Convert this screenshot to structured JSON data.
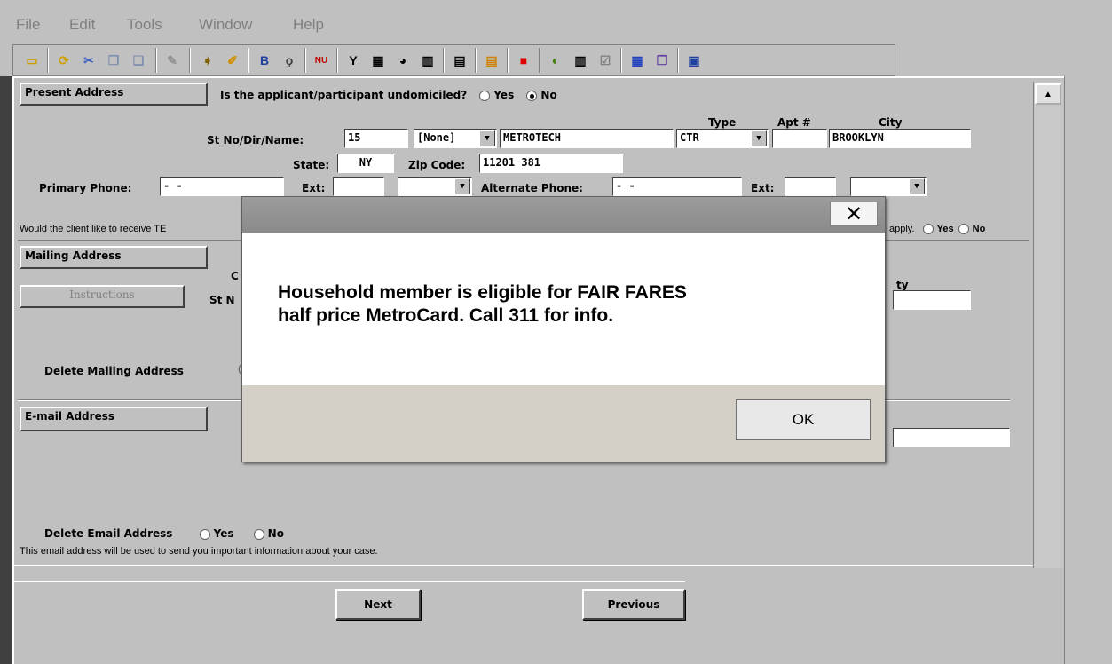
{
  "menu": [
    "File",
    "Edit",
    "Tools",
    "Window",
    "Help"
  ],
  "present": {
    "section_label": "Present Address",
    "undomiciled_question": "Is the applicant/participant undomiciled?",
    "yes": "Yes",
    "no": "No",
    "selected": "No",
    "type_header": "Type",
    "apt_header": "Apt #",
    "city_header": "City",
    "st_label": "St No/Dir/Name:",
    "st_no": "15",
    "dir": "[None]",
    "street": "METROTECH",
    "type": "CTR",
    "apt": "",
    "city": "BROOKLYN",
    "state_label": "State:",
    "state": "NY",
    "zip_label": "Zip Code:",
    "zip": "11201 381",
    "primary_phone_label": "Primary Phone:",
    "primary_phone": " -  -",
    "ext_label": "Ext:",
    "ext": "",
    "alt_phone_label": "Alternate Phone:",
    "alt_phone": " -  -",
    "alt_ext_label": "Ext:",
    "alt_ext": ""
  },
  "text_question_start": "Would the client like to receive TE",
  "text_question_end": "apply.",
  "text_yes": "Yes",
  "text_no": "No",
  "mailing": {
    "section_label": "Mailing Address",
    "instructions": "Instructions",
    "st_label_partial": "St N",
    "c_partial": "C",
    "city_partial": "ty",
    "delete_label": "Delete Mailing Address"
  },
  "email": {
    "section_label": "E-mail Address",
    "delete_label": "Delete Email Address",
    "yes": "Yes",
    "no": "No",
    "note": "This email address will be used to send you important information about your case."
  },
  "nav": {
    "next": "Next",
    "previous": "Previous"
  },
  "dialog": {
    "message": "Household member is eligible for FAIR FARES\nhalf price MetroCard.  Call 311 for info.",
    "ok": "OK",
    "close": "✕"
  }
}
